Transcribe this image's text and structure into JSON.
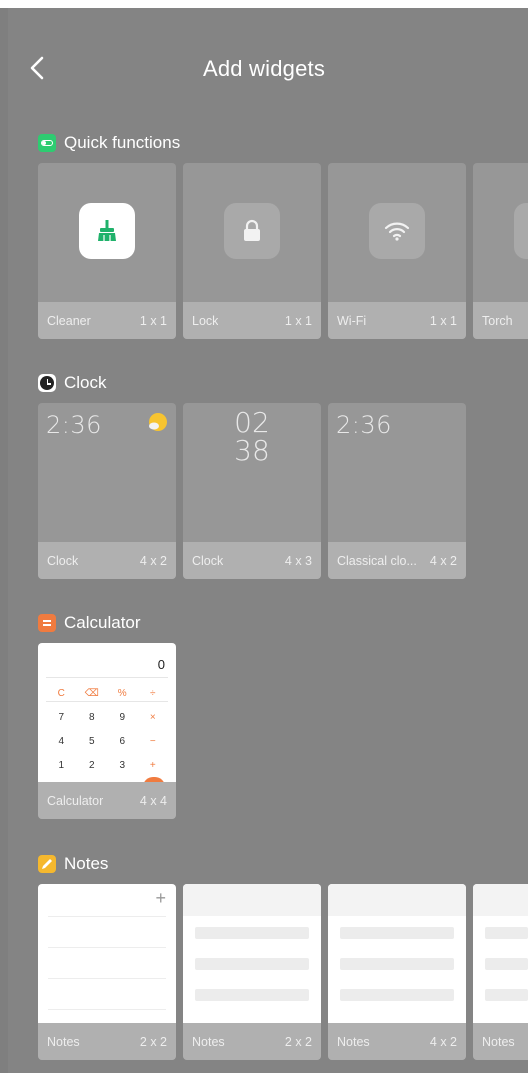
{
  "header": {
    "title": "Add widgets",
    "back_icon": "chevron-left-icon"
  },
  "sections": {
    "quick": {
      "title": "Quick functions",
      "icon": "toggle-icon",
      "icon_color": "#2ecc71",
      "items": [
        {
          "name": "Cleaner",
          "size": "1 x 1",
          "icon": "broom-icon",
          "icon_color": "#20b26b"
        },
        {
          "name": "Lock",
          "size": "1 x 1",
          "icon": "lock-icon"
        },
        {
          "name": "Wi-Fi",
          "size": "1 x 1",
          "icon": "wifi-icon"
        },
        {
          "name": "Torch",
          "size": ""
        }
      ]
    },
    "clock": {
      "title": "Clock",
      "icon": "clock-icon",
      "items": [
        {
          "name": "Clock",
          "size": "4 x 2",
          "time": "2:36",
          "icon": "sun-icon",
          "icon_color": "#f7c430"
        },
        {
          "name": "Clock",
          "size": "4 x 3",
          "hours": "02",
          "minutes": "38"
        },
        {
          "name": "Classical clo...",
          "size": "4 x 2",
          "time": "2:36"
        }
      ]
    },
    "calculator": {
      "title": "Calculator",
      "icon": "calculator-icon",
      "icon_color": "#f07b3f",
      "items": [
        {
          "name": "Calculator",
          "size": "4 x 4",
          "display": "0",
          "keys": [
            [
              "C",
              "⌫",
              "%",
              "÷"
            ],
            [
              "7",
              "8",
              "9",
              "×"
            ],
            [
              "4",
              "5",
              "6",
              "−"
            ],
            [
              "1",
              "2",
              "3",
              "+"
            ]
          ]
        }
      ]
    },
    "notes": {
      "title": "Notes",
      "icon": "pencil-icon",
      "icon_color": "#f5b82e",
      "items": [
        {
          "name": "Notes",
          "size": "2 x 2",
          "plus": "+"
        },
        {
          "name": "Notes",
          "size": "2 x 2"
        },
        {
          "name": "Notes",
          "size": "4 x 2"
        },
        {
          "name": "Notes",
          "size": ""
        }
      ]
    }
  },
  "colors": {
    "background": "#848484",
    "accent_orange": "#f07b3f",
    "accent_green": "#2ecc71"
  }
}
